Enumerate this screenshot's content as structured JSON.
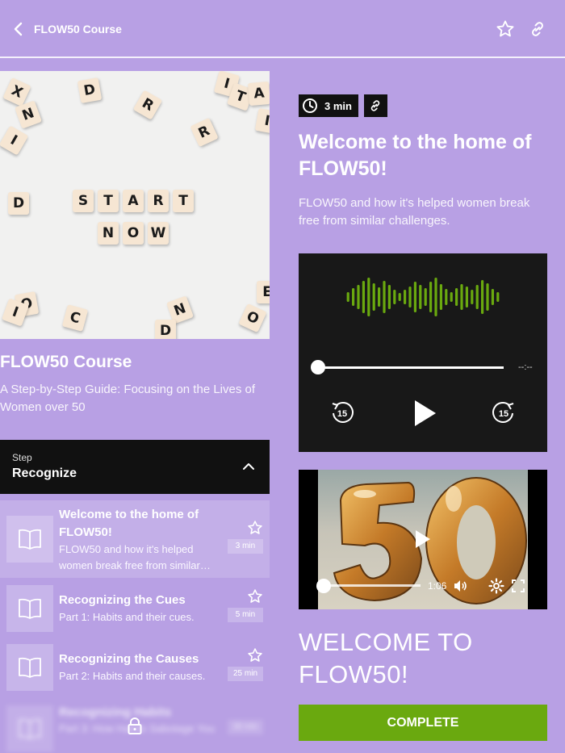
{
  "header": {
    "back_label": "FLOW50 Course",
    "icons": [
      "chevron-left-icon",
      "star-icon",
      "link-icon"
    ]
  },
  "hero_image": {
    "letters_line1": [
      "S",
      "T",
      "A",
      "R",
      "T"
    ],
    "letters_line2": [
      "N",
      "O",
      "W"
    ],
    "scattered": [
      "D",
      "I",
      "T",
      "A",
      "X",
      "N",
      "R",
      "R",
      "I",
      "I",
      "D",
      "O",
      "I",
      "C",
      "N",
      "D",
      "O",
      "E"
    ]
  },
  "course": {
    "title": "FLOW50 Course",
    "subtitle": "A Step-by-Step Guide: Focusing on the Lives of Women over 50"
  },
  "step": {
    "label": "Step",
    "name": "Recognize"
  },
  "lessons": [
    {
      "title": "Welcome to the home of FLOW50!",
      "desc": "FLOW50 and how it's helped women break free from similar…",
      "duration": "3 min",
      "active": true
    },
    {
      "title": "Recognizing the Cues",
      "desc": "Part 1: Habits and their cues.",
      "duration": "5 min"
    },
    {
      "title": "Recognizing the Causes",
      "desc": "Part 2: Habits and their causes.",
      "duration": "25 min"
    },
    {
      "title": "Recognizing Habits",
      "desc": "Part 3: How Habits Sabotage You",
      "duration": "30 min",
      "locked": true
    }
  ],
  "main": {
    "duration_badge": "3 min",
    "title": "Welcome to the home of FLOW50!",
    "description": "FLOW50 and how it's helped women break free from similar challenges.",
    "audio": {
      "time": "--:--",
      "skip_back": "15",
      "skip_forward": "15",
      "progress": 0,
      "wave_color": "#6aa90f"
    },
    "video": {
      "time": "1:06",
      "progress": 0,
      "poster_text": "50"
    },
    "heading": "WELCOME TO FLOW50!",
    "complete_label": "COMPLETE"
  },
  "colors": {
    "background": "#b8a0e4",
    "accent_green": "#6aa90f",
    "dark": "#111111"
  }
}
